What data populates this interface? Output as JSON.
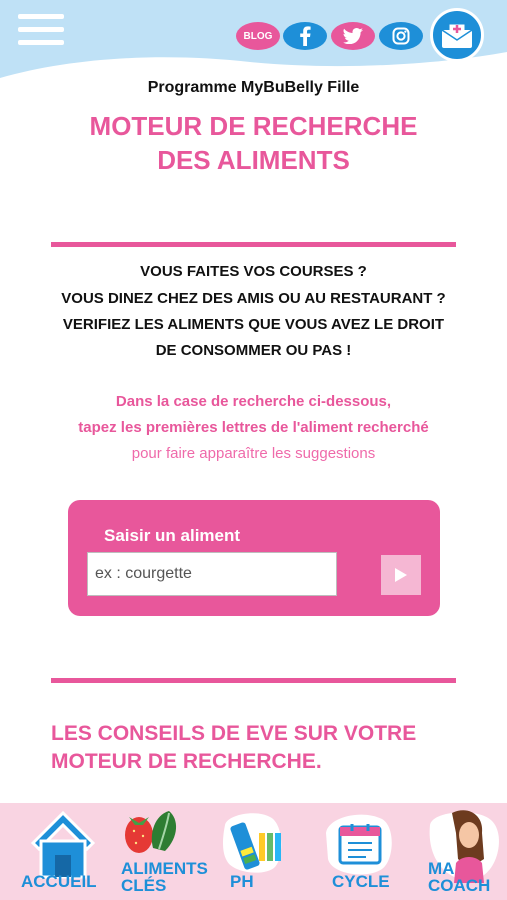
{
  "header": {
    "menu_icon": "hamburger-menu-icon",
    "blog_label": "BLOG",
    "social_icons": [
      "facebook-icon",
      "twitter-icon",
      "instagram-icon"
    ],
    "contact_icon": "mail-icon"
  },
  "program": "Programme MyBuBelly Fille",
  "title": [
    "MOTEUR DE RECHERCHE",
    "DES ALIMENTS"
  ],
  "questions": [
    "VOUS FAITES VOS COURSES ?",
    "VOUS DINEZ CHEZ DES AMIS OU AU RESTAURANT ?",
    "VERIFIEZ LES ALIMENTS QUE VOUS AVEZ LE DROIT",
    "DE CONSOMMER OU PAS  !"
  ],
  "hint": [
    "Dans la case de recherche ci-dessous,",
    "tapez les premières lettres de l'aliment recherché",
    "pour faire apparaître les suggestions"
  ],
  "search": {
    "label": "Saisir un aliment",
    "placeholder": "ex : courgette",
    "value": ""
  },
  "advice": [
    "LES CONSEILS DE EVE SUR VOTRE",
    "MOTEUR DE RECHERCHE."
  ],
  "nav": {
    "accueil": "ACCUEIL",
    "aliments": [
      "ALIMENTS",
      "CLÉS"
    ],
    "ph": "PH",
    "cycle": "CYCLE",
    "coach": [
      "MA",
      "COACH"
    ]
  },
  "colors": {
    "pink": "#e8579b",
    "blue": "#1e8fd8",
    "header_blue": "#bfe1f6",
    "nav_bg": "#f9d4e2"
  }
}
